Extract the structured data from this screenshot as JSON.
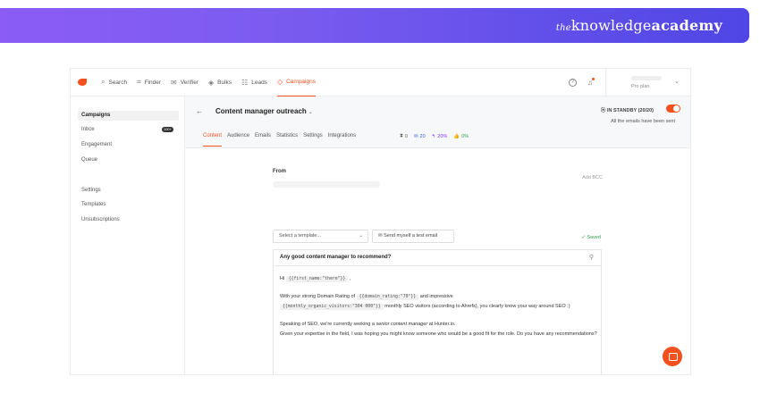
{
  "banner": {
    "brand_the": "the",
    "brand_knowledge": "knowledge",
    "brand_academy": "academy"
  },
  "nav": {
    "items": [
      {
        "icon": "search-icon",
        "label": "Search"
      },
      {
        "icon": "finder-icon",
        "label": "Finder"
      },
      {
        "icon": "verifier-icon",
        "label": "Verifier"
      },
      {
        "icon": "bulks-icon",
        "label": "Bulks"
      },
      {
        "icon": "leads-icon",
        "label": "Leads"
      },
      {
        "icon": "campaigns-icon",
        "label": "Campaigns",
        "active": true
      }
    ],
    "help": "?",
    "plan": "Pro plan"
  },
  "sidebar": {
    "items": [
      {
        "label": "Campaigns",
        "active": true
      },
      {
        "label": "Inbox",
        "badge": "100+"
      },
      {
        "label": "Engagement"
      },
      {
        "label": "Queue"
      },
      {
        "label": "Settings"
      },
      {
        "label": "Templates"
      },
      {
        "label": "Unsubscriptions"
      }
    ]
  },
  "campaign": {
    "title": "Content manager outreach",
    "status": "IN STANDBY (20/20)",
    "note": "All the emails have been sent",
    "tabs": [
      "Content",
      "Audience",
      "Emails",
      "Statistics",
      "Settings",
      "Integrations"
    ],
    "stats": [
      {
        "icon": "hourglass-icon",
        "value": "0",
        "color": "#555555"
      },
      {
        "icon": "mail-icon",
        "value": "20",
        "color": "#3b5bdb"
      },
      {
        "icon": "reply-icon",
        "value": "20%",
        "color": "#7c3aed"
      },
      {
        "icon": "thumbs-up-icon",
        "value": "0%",
        "color": "#2e9d4e"
      }
    ]
  },
  "compose": {
    "from_label": "From",
    "add_bcc": "Add BCC",
    "template_placeholder": "Select a template...",
    "test_email": "Send myself a test email",
    "saved": "Saved",
    "subject": "Any good content manager to recommend?",
    "greeting_pre": "Hi",
    "greeting_var": "{{first_name:\"there\"}}",
    "greeting_post": ",",
    "p1_a": "With your strong Domain Rating of",
    "p1_var1": "{{domain_rating:\"70\"}}",
    "p1_b": "and impressive",
    "p1_var2": "{{monthly_organic_visitors:\"304 000\"}}",
    "p1_c": "monthly SEO visitors (according to Ahrefs), you clearly know your way around SEO :)",
    "p2_a": "Speaking of SEO, we're currently seeking a",
    "p2_em": "senior content manager",
    "p2_b": "at Hunter.io.",
    "p3": "Given your expertise in the field, I was hoping you might know someone who would be a good fit for the role. Do you have any recommendations?"
  },
  "colors": {
    "accent": "#f4511e",
    "banner_start": "#8b5cf6",
    "banner_end": "#4f46e5",
    "saved_green": "#2e9d4e"
  }
}
